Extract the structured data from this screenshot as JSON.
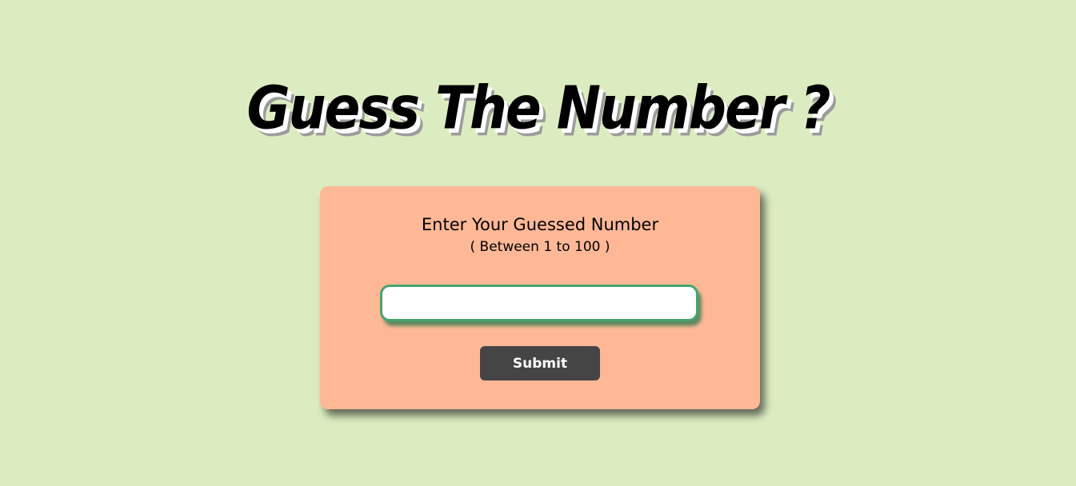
{
  "header": {
    "title": "Guess The Number ?"
  },
  "form": {
    "prompt": "Enter Your Guessed Number",
    "hint": "( Between 1 to 100 )",
    "input_value": "",
    "submit_label": "Submit"
  },
  "colors": {
    "background": "#dbedc0",
    "card": "#ffb896",
    "input_border": "#44a66d",
    "button": "#454545",
    "button_text": "#ffffff"
  }
}
